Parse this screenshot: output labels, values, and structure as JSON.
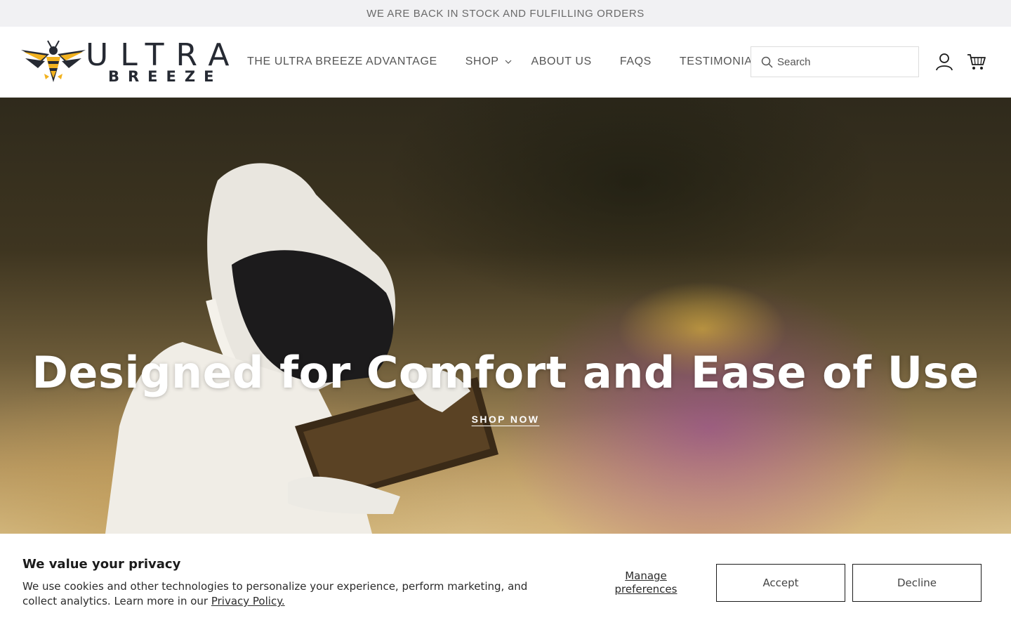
{
  "announcement": "WE ARE BACK IN STOCK AND FULFILLING ORDERS",
  "logo": {
    "word1": "ULTRA",
    "word2": "BREEZE"
  },
  "nav": {
    "items": [
      {
        "label": "THE ULTRA BREEZE ADVANTAGE"
      },
      {
        "label": "SHOP"
      },
      {
        "label": "ABOUT US"
      },
      {
        "label": "FAQS"
      },
      {
        "label": "TESTIMONIALS"
      }
    ]
  },
  "search": {
    "placeholder": "Search"
  },
  "icons": {
    "search": "search-icon",
    "account": "user-icon",
    "cart": "cart-icon",
    "dropdown": "chevron-down-icon"
  },
  "hero": {
    "title": "Designed for Comfort and Ease of Use",
    "cta": "SHOP NOW"
  },
  "cookie": {
    "title": "We value your privacy",
    "text": "We use cookies and other technologies to personalize your experience, perform marketing, and collect analytics. Learn more in our ",
    "link": "Privacy Policy.",
    "manage_line1": "Manage",
    "manage_line2": "preferences",
    "accept": "Accept",
    "decline": "Decline"
  },
  "colors": {
    "brand_yellow": "#f2b21f",
    "brand_dark": "#262a33",
    "announce_bg": "#f1f1f3"
  }
}
